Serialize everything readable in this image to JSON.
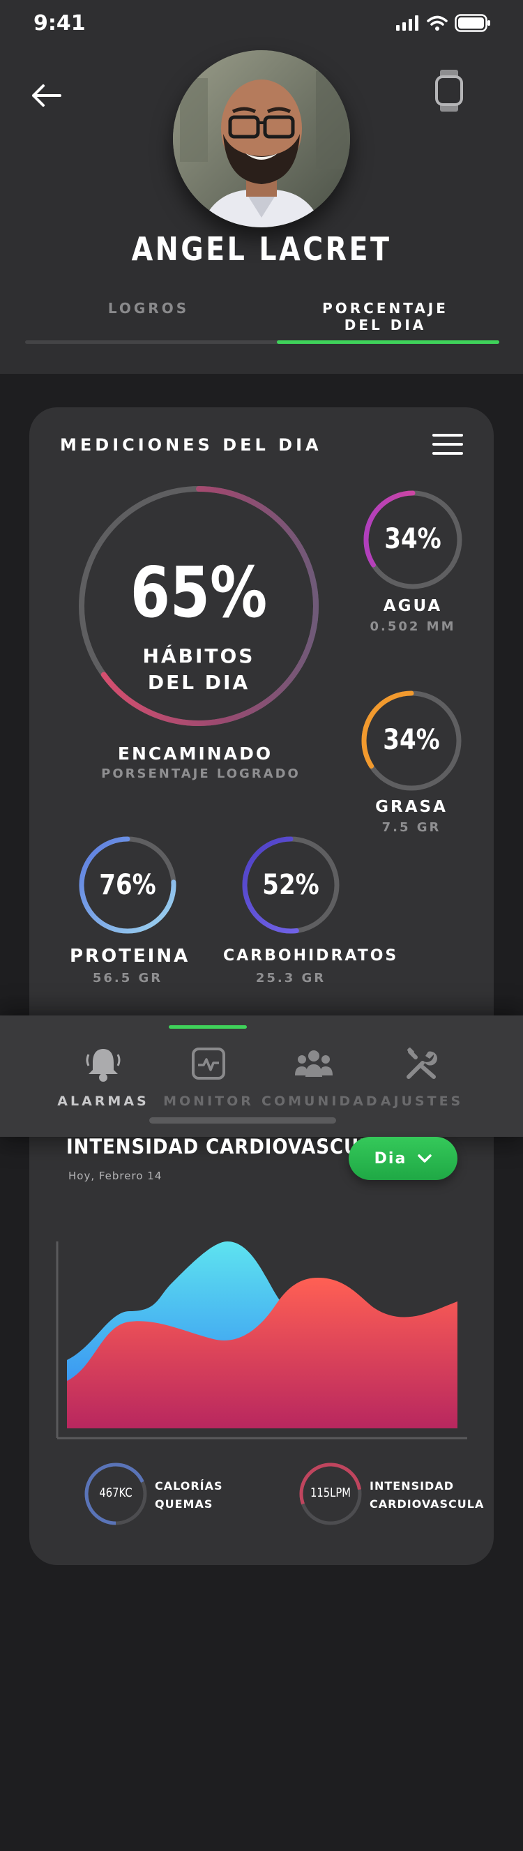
{
  "status_bar": {
    "time": "9:41"
  },
  "profile": {
    "name": "ANGEL LACRET"
  },
  "tabs": [
    {
      "label_line1": "LOGROS",
      "label_line2": ""
    },
    {
      "label_line1": "PORCENTAJE",
      "label_line2": "DEL DIA"
    }
  ],
  "mediciones": {
    "title": "MEDICIONES DEL DIA",
    "main": {
      "percent": "65%",
      "value": 0.65,
      "line1": "HÁBITOS",
      "line2": "DEL DIA",
      "status": "ENCAMINADO",
      "caption": "PORSENTAJE LOGRADO"
    },
    "agua": {
      "percent": "34%",
      "value": 0.34,
      "name": "AGUA",
      "amount": "0.502 MM"
    },
    "grasa": {
      "percent": "34%",
      "value": 0.34,
      "name": "GRASA",
      "amount": "7.5 GR"
    },
    "proteina": {
      "percent": "76%",
      "value": 0.76,
      "name": "PROTEINA",
      "amount": "56.5 GR"
    },
    "carbohidratos": {
      "percent": "52%",
      "value": 0.52,
      "name": "CARBOHIDRATOS",
      "amount": "25.3 GR"
    }
  },
  "nav": [
    {
      "label": "ALARMAS",
      "icon": "bell-icon"
    },
    {
      "label": "MONITOR",
      "icon": "monitor-heart-icon"
    },
    {
      "label": "COMUNIDAD",
      "icon": "community-icon"
    },
    {
      "label": "AJUSTES",
      "icon": "tools-icon"
    }
  ],
  "cardio": {
    "title": "INTENSIDAD CARDIOVASCULAR",
    "date": "Hoy, Febrero 14",
    "period_button": "Dia",
    "stats": [
      {
        "value": "467KC",
        "line1": "CALORÍAS",
        "line2": "QUEMAS"
      },
      {
        "value": "115LPM",
        "line1": "INTENSIDAD",
        "line2": "CARDIOVASCULA"
      }
    ]
  },
  "colors": {
    "accent_green": "#3fd25a",
    "main_ring": "#d1496d",
    "agua_ring": "#d13fa0",
    "grasa_ring": "#f29a2e",
    "proteina_ring": "#6fa8f0",
    "carbohidratos_ring": "#6b5be0"
  }
}
